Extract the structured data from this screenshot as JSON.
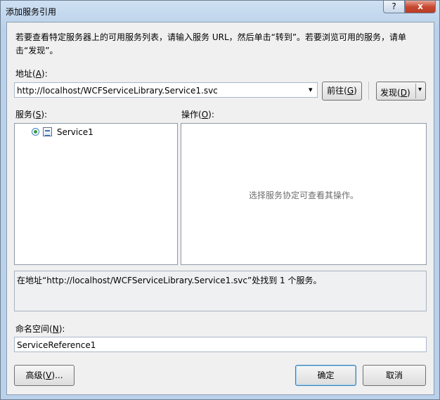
{
  "window": {
    "title": "添加服务引用",
    "help_label": "?",
    "close_label": "x"
  },
  "instructions": "若要查看特定服务器上的可用服务列表，请输入服务 URL，然后单击“转到”。若要浏览可用的服务，请单击“发现”。",
  "address": {
    "label": "地址",
    "accesskey": "A",
    "value": "http://localhost/WCFServiceLibrary.Service1.svc",
    "go_button": {
      "label": "前往",
      "accesskey": "G"
    },
    "discover_button": {
      "label": "发现",
      "accesskey": "D"
    },
    "dropdown_arrow": "▾"
  },
  "services": {
    "label": "服务",
    "accesskey": "S",
    "items": [
      {
        "name": "Service1",
        "icon": "service-icon"
      }
    ]
  },
  "operations": {
    "label": "操作",
    "accesskey": "O",
    "placeholder": "选择服务协定可查看其操作。"
  },
  "status": {
    "text": "在地址“http://localhost/WCFServiceLibrary.Service1.svc”处找到 1 个服务。"
  },
  "namespace": {
    "label": "命名空间",
    "accesskey": "N",
    "value": "ServiceReference1"
  },
  "buttons": {
    "advanced": {
      "label": "高级",
      "accesskey": "V",
      "suffix": "..."
    },
    "ok": "确定",
    "cancel": "取消"
  }
}
